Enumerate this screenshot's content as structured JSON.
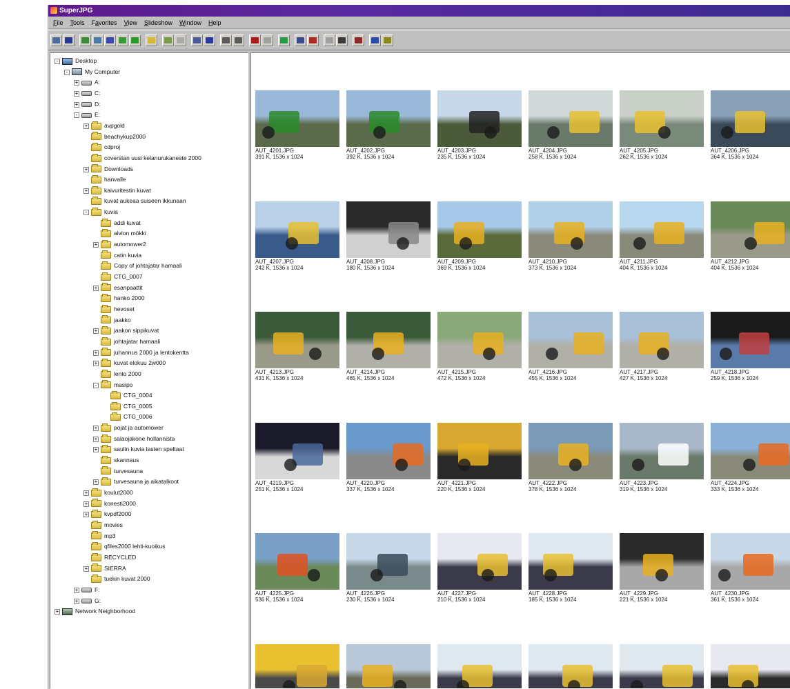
{
  "window": {
    "title": "SuperJPG"
  },
  "menu": [
    {
      "pre": "",
      "u": "F",
      "post": "ile"
    },
    {
      "pre": "",
      "u": "T",
      "post": "ools"
    },
    {
      "pre": "F",
      "u": "a",
      "post": "vorites"
    },
    {
      "pre": "",
      "u": "V",
      "post": "iew"
    },
    {
      "pre": "",
      "u": "S",
      "post": "lideshow"
    },
    {
      "pre": "",
      "u": "W",
      "post": "indow"
    },
    {
      "pre": "",
      "u": "H",
      "post": "elp"
    }
  ],
  "toolbar_groups": [
    [
      {
        "icon": "open-icon",
        "color": "#4a6a9a"
      },
      {
        "icon": "forward-arrow-icon",
        "color": "#2a3a8a"
      }
    ],
    [
      {
        "icon": "copy-icon",
        "color": "#3a8a3a"
      },
      {
        "icon": "move-icon",
        "color": "#4a7aaa"
      },
      {
        "icon": "undo-icon",
        "color": "#3a4aaa"
      },
      {
        "icon": "up-icon",
        "color": "#3a9a3a"
      },
      {
        "icon": "back-arrow-icon",
        "color": "#2a9a2a"
      }
    ],
    [
      {
        "icon": "folder-icon",
        "color": "#d8b838"
      }
    ],
    [
      {
        "icon": "image-icon",
        "color": "#7a9a4a"
      },
      {
        "icon": "blank-icon",
        "color": "#aaaaaa"
      }
    ],
    [
      {
        "icon": "split-icon",
        "color": "#4a5a9a"
      },
      {
        "icon": "thumbnails-icon",
        "color": "#2a3a9a"
      }
    ],
    [
      {
        "icon": "fit-icon",
        "color": "#5a5a5a"
      },
      {
        "icon": "zoom-icon",
        "color": "#5a5a5a"
      }
    ],
    [
      {
        "icon": "delete-icon",
        "color": "#aa1a1a"
      },
      {
        "icon": "delete-disabled-icon",
        "color": "#a0a0a0"
      }
    ],
    [
      {
        "icon": "rotate-icon",
        "color": "#2a9a4a"
      }
    ],
    [
      {
        "icon": "minimize-icon",
        "color": "#3a4a8a"
      },
      {
        "icon": "close-folder-icon",
        "color": "#aa2a2a"
      }
    ],
    [
      {
        "icon": "print-preview-icon",
        "color": "#a0a0a0"
      },
      {
        "icon": "print-icon",
        "color": "#3a3a3a"
      }
    ],
    [
      {
        "icon": "settings-icon",
        "color": "#8a2a2a"
      }
    ],
    [
      {
        "icon": "help-context-icon",
        "color": "#2a4aaa"
      },
      {
        "icon": "help-icon",
        "color": "#8a8a1a"
      }
    ]
  ],
  "tree": [
    {
      "label": "Desktop",
      "level": 0,
      "icon": "desktop",
      "exp": "-"
    },
    {
      "label": "My Computer",
      "level": 1,
      "icon": "computer",
      "exp": "-"
    },
    {
      "label": "A:",
      "level": 2,
      "icon": "drive",
      "exp": "+"
    },
    {
      "label": "C:",
      "level": 2,
      "icon": "drive",
      "exp": "+"
    },
    {
      "label": "D:",
      "level": 2,
      "icon": "drive",
      "exp": "+"
    },
    {
      "label": "E:",
      "level": 2,
      "icon": "drive",
      "exp": "-"
    },
    {
      "label": "avpgold",
      "level": 3,
      "icon": "folder",
      "exp": "+"
    },
    {
      "label": "beachykup2000",
      "level": 3,
      "icon": "folder",
      "exp": ""
    },
    {
      "label": "cdproj",
      "level": 3,
      "icon": "folder",
      "exp": ""
    },
    {
      "label": "coverstan uusi kelanurukaneste 2000",
      "level": 3,
      "icon": "folder",
      "exp": ""
    },
    {
      "label": "Downloads",
      "level": 3,
      "icon": "folder",
      "exp": "+"
    },
    {
      "label": "hanvalle",
      "level": 3,
      "icon": "folder",
      "exp": ""
    },
    {
      "label": "kaivuritestin kuvat",
      "level": 3,
      "icon": "folder",
      "exp": "+"
    },
    {
      "label": "kuvat aukeaa suiseen ikkunaan",
      "level": 3,
      "icon": "folder",
      "exp": ""
    },
    {
      "label": "kuvia",
      "level": 3,
      "icon": "folder",
      "exp": "-"
    },
    {
      "label": "addi kuvat",
      "level": 4,
      "icon": "folder",
      "exp": ""
    },
    {
      "label": "alvion mökki",
      "level": 4,
      "icon": "folder",
      "exp": ""
    },
    {
      "label": "automower2",
      "level": 4,
      "icon": "folder",
      "exp": "+"
    },
    {
      "label": "catin kuvia",
      "level": 4,
      "icon": "folder",
      "exp": ""
    },
    {
      "label": "Copy of johtajatar hamaali",
      "level": 4,
      "icon": "folder",
      "exp": ""
    },
    {
      "label": "CTG_0007",
      "level": 4,
      "icon": "folder",
      "exp": ""
    },
    {
      "label": "esanpaattit",
      "level": 4,
      "icon": "folder",
      "exp": "+"
    },
    {
      "label": "hanko 2000",
      "level": 4,
      "icon": "folder",
      "exp": ""
    },
    {
      "label": "hevoset",
      "level": 4,
      "icon": "folder",
      "exp": ""
    },
    {
      "label": "jaakko",
      "level": 4,
      "icon": "folder",
      "exp": ""
    },
    {
      "label": "jaakon sippikuvat",
      "level": 4,
      "icon": "folder",
      "exp": "+"
    },
    {
      "label": "johtajatar hamaali",
      "level": 4,
      "icon": "folder",
      "exp": ""
    },
    {
      "label": "juhannus 2000 ja lentokentta",
      "level": 4,
      "icon": "folder",
      "exp": "+"
    },
    {
      "label": "kuvat elokuu 2w000",
      "level": 4,
      "icon": "folder",
      "exp": "+"
    },
    {
      "label": "lento 2000",
      "level": 4,
      "icon": "folder",
      "exp": ""
    },
    {
      "label": "masipo",
      "level": 4,
      "icon": "folder",
      "exp": "-"
    },
    {
      "label": "CTG_0004",
      "level": 5,
      "icon": "folder",
      "exp": ""
    },
    {
      "label": "CTG_0005",
      "level": 5,
      "icon": "folder",
      "exp": ""
    },
    {
      "label": "CTG_0006",
      "level": 5,
      "icon": "folder",
      "exp": ""
    },
    {
      "label": "pojat ja automower",
      "level": 4,
      "icon": "folder",
      "exp": "+"
    },
    {
      "label": "salaojakone hollannista",
      "level": 4,
      "icon": "folder",
      "exp": "+"
    },
    {
      "label": "saulin kuvia lasten speltaat",
      "level": 4,
      "icon": "folder",
      "exp": "+"
    },
    {
      "label": "skannaus",
      "level": 4,
      "icon": "folder",
      "exp": ""
    },
    {
      "label": "turvesauna",
      "level": 4,
      "icon": "folder",
      "exp": ""
    },
    {
      "label": "turvesauna ja aikatalkoot",
      "level": 4,
      "icon": "folder",
      "exp": "+"
    },
    {
      "label": "koulut2000",
      "level": 3,
      "icon": "folder",
      "exp": "+"
    },
    {
      "label": "konesti2000",
      "level": 3,
      "icon": "folder",
      "exp": "+"
    },
    {
      "label": "kvpdf2000",
      "level": 3,
      "icon": "folder",
      "exp": "+"
    },
    {
      "label": "movies",
      "level": 3,
      "icon": "folder",
      "exp": ""
    },
    {
      "label": "mp3",
      "level": 3,
      "icon": "folder",
      "exp": ""
    },
    {
      "label": "qfiles2000 lehti-kuoikus",
      "level": 3,
      "icon": "folder",
      "exp": ""
    },
    {
      "label": "RECYCLED",
      "level": 3,
      "icon": "folder",
      "exp": ""
    },
    {
      "label": "SIERRA",
      "level": 3,
      "icon": "folder",
      "exp": "+"
    },
    {
      "label": "tuekin kuvat 2000",
      "level": 3,
      "icon": "folder",
      "exp": ""
    },
    {
      "label": "F:",
      "level": 2,
      "icon": "drive",
      "exp": "+"
    },
    {
      "label": "G:",
      "level": 2,
      "icon": "drive",
      "exp": "+"
    },
    {
      "label": "Network Neighborhood",
      "level": 0,
      "icon": "network",
      "exp": "+"
    }
  ],
  "thumbnails": [
    {
      "name": "AUT_4201.JPG",
      "meta": "391 K, 1536 x 1024",
      "sky": "#9ab8d8",
      "ground": "#5a6a4a",
      "accent": "#2a8a2a"
    },
    {
      "name": "AUT_4202.JPG",
      "meta": "392 K, 1536 x 1024",
      "sky": "#9ab8d8",
      "ground": "#5a6a4a",
      "accent": "#2a8a2a"
    },
    {
      "name": "AUT_4203.JPG",
      "meta": "235 K, 1536 x 1024",
      "sky": "#c8d8e8",
      "ground": "#4a5a3a",
      "accent": "#222222"
    },
    {
      "name": "AUT_4204.JPG",
      "meta": "258 K, 1536 x 1024",
      "sky": "#d0d8d8",
      "ground": "#6a7a6a",
      "accent": "#e8c030"
    },
    {
      "name": "AUT_4205.JPG",
      "meta": "262 K, 1536 x 1024",
      "sky": "#c8d0c8",
      "ground": "#7a8a7a",
      "accent": "#e8c030"
    },
    {
      "name": "AUT_4206.JPG",
      "meta": "364 K, 1536 x 1024",
      "sky": "#8aa0b8",
      "ground": "#3a4a5a",
      "accent": "#e8c030"
    },
    {
      "name": "AUT_4207.JPG",
      "meta": "242 K, 1536 x 1024",
      "sky": "#b8d0e8",
      "ground": "#3a5a8a",
      "accent": "#e8c030"
    },
    {
      "name": "AUT_4208.JPG",
      "meta": "180 K, 1536 x 1024",
      "sky": "#2a2a2a",
      "ground": "#d0d0d0",
      "accent": "#888888"
    },
    {
      "name": "AUT_4209.JPG",
      "meta": "369 K, 1536 x 1024",
      "sky": "#a8c8e8",
      "ground": "#5a6a3a",
      "accent": "#e8b020"
    },
    {
      "name": "AUT_4210.JPG",
      "meta": "373 K, 1536 x 1024",
      "sky": "#b0d0e8",
      "ground": "#8a8a7a",
      "accent": "#e8b020"
    },
    {
      "name": "AUT_4211.JPG",
      "meta": "404 K, 1536 x 1024",
      "sky": "#b8d8f0",
      "ground": "#8a8a7a",
      "accent": "#e8b020"
    },
    {
      "name": "AUT_4212.JPG",
      "meta": "404 K, 1536 x 1024",
      "sky": "#6a8a5a",
      "ground": "#9a9a8a",
      "accent": "#e8b020"
    },
    {
      "name": "AUT_4213.JPG",
      "meta": "431 K, 1536 x 1024",
      "sky": "#3a5a3a",
      "ground": "#9a9a8a",
      "accent": "#e8b020"
    },
    {
      "name": "AUT_4214.JPG",
      "meta": "465 K, 1536 x 1024",
      "sky": "#3a5a3a",
      "ground": "#b0b0a8",
      "accent": "#e8b020"
    },
    {
      "name": "AUT_4215.JPG",
      "meta": "472 K, 1536 x 1024",
      "sky": "#8aa87a",
      "ground": "#b0b0a8",
      "accent": "#e8b020"
    },
    {
      "name": "AUT_4216.JPG",
      "meta": "455 K, 1536 x 1024",
      "sky": "#a8c0d8",
      "ground": "#b0b0a8",
      "accent": "#e8b020"
    },
    {
      "name": "AUT_4217.JPG",
      "meta": "427 K, 1536 x 1024",
      "sky": "#a8c0d8",
      "ground": "#b0b0a8",
      "accent": "#e8b020"
    },
    {
      "name": "AUT_4218.JPG",
      "meta": "259 K, 1536 x 1024",
      "sky": "#1a1a1a",
      "ground": "#5a7aaa",
      "accent": "#c04040"
    },
    {
      "name": "AUT_4219.JPG",
      "meta": "251 K, 1536 x 1024",
      "sky": "#1a1a2a",
      "ground": "#d8d8d8",
      "accent": "#4a6a9a"
    },
    {
      "name": "AUT_4220.JPG",
      "meta": "337 K, 1536 x 1024",
      "sky": "#6a9acc",
      "ground": "#8a8a8a",
      "accent": "#e86a20"
    },
    {
      "name": "AUT_4221.JPG",
      "meta": "220 K, 1536 x 1024",
      "sky": "#d8a830",
      "ground": "#2a2a2a",
      "accent": "#e8b020"
    },
    {
      "name": "AUT_4222.JPG",
      "meta": "378 K, 1536 x 1024",
      "sky": "#7a9ab8",
      "ground": "#8a8a7a",
      "accent": "#e8b020"
    },
    {
      "name": "AUT_4223.JPG",
      "meta": "319 K, 1536 x 1024",
      "sky": "#a8b8c8",
      "ground": "#6a7a6a",
      "accent": "#ffffff"
    },
    {
      "name": "AUT_4224.JPG",
      "meta": "333 K, 1536 x 1024",
      "sky": "#8ab0d8",
      "ground": "#8a8a7a",
      "accent": "#e86a20"
    },
    {
      "name": "AUT_4225.JPG",
      "meta": "536 K, 1536 x 1024",
      "sky": "#7aa0c8",
      "ground": "#6a8a5a",
      "accent": "#e05020"
    },
    {
      "name": "AUT_4226.JPG",
      "meta": "230 K, 1536 x 1024",
      "sky": "#c8d8e8",
      "ground": "#7a8a8a",
      "accent": "#3a4a5a"
    },
    {
      "name": "AUT_4227.JPG",
      "meta": "210 K, 1536 x 1024",
      "sky": "#e8e8f0",
      "ground": "#3a3a4a",
      "accent": "#e8c030"
    },
    {
      "name": "AUT_4228.JPG",
      "meta": "185 K, 1536 x 1024",
      "sky": "#e0e8f0",
      "ground": "#3a3a4a",
      "accent": "#e8c030"
    },
    {
      "name": "AUT_4229.JPG",
      "meta": "221 K, 1536 x 1024",
      "sky": "#2a2a2a",
      "ground": "#a8a8a8",
      "accent": "#e8b020"
    },
    {
      "name": "AUT_4230.JPG",
      "meta": "361 K, 1536 x 1024",
      "sky": "#c8d8e8",
      "ground": "#a8a8a8",
      "accent": "#e86a20"
    },
    {
      "name": "",
      "meta": "",
      "sky": "#e8c030",
      "ground": "#4a4a4a",
      "accent": "#d8a830"
    },
    {
      "name": "",
      "meta": "",
      "sky": "#b8c8d8",
      "ground": "#6a6a5a",
      "accent": "#e8b020"
    },
    {
      "name": "",
      "meta": "",
      "sky": "#e0e8f0",
      "ground": "#3a3a4a",
      "accent": "#e8c030"
    },
    {
      "name": "",
      "meta": "",
      "sky": "#e0e8f0",
      "ground": "#3a3a4a",
      "accent": "#e8c030"
    },
    {
      "name": "",
      "meta": "",
      "sky": "#e0e8f0",
      "ground": "#3a3a4a",
      "accent": "#e8c030"
    },
    {
      "name": "",
      "meta": "",
      "sky": "#e8e8f0",
      "ground": "#2a2a2a",
      "accent": "#e8c030"
    }
  ]
}
